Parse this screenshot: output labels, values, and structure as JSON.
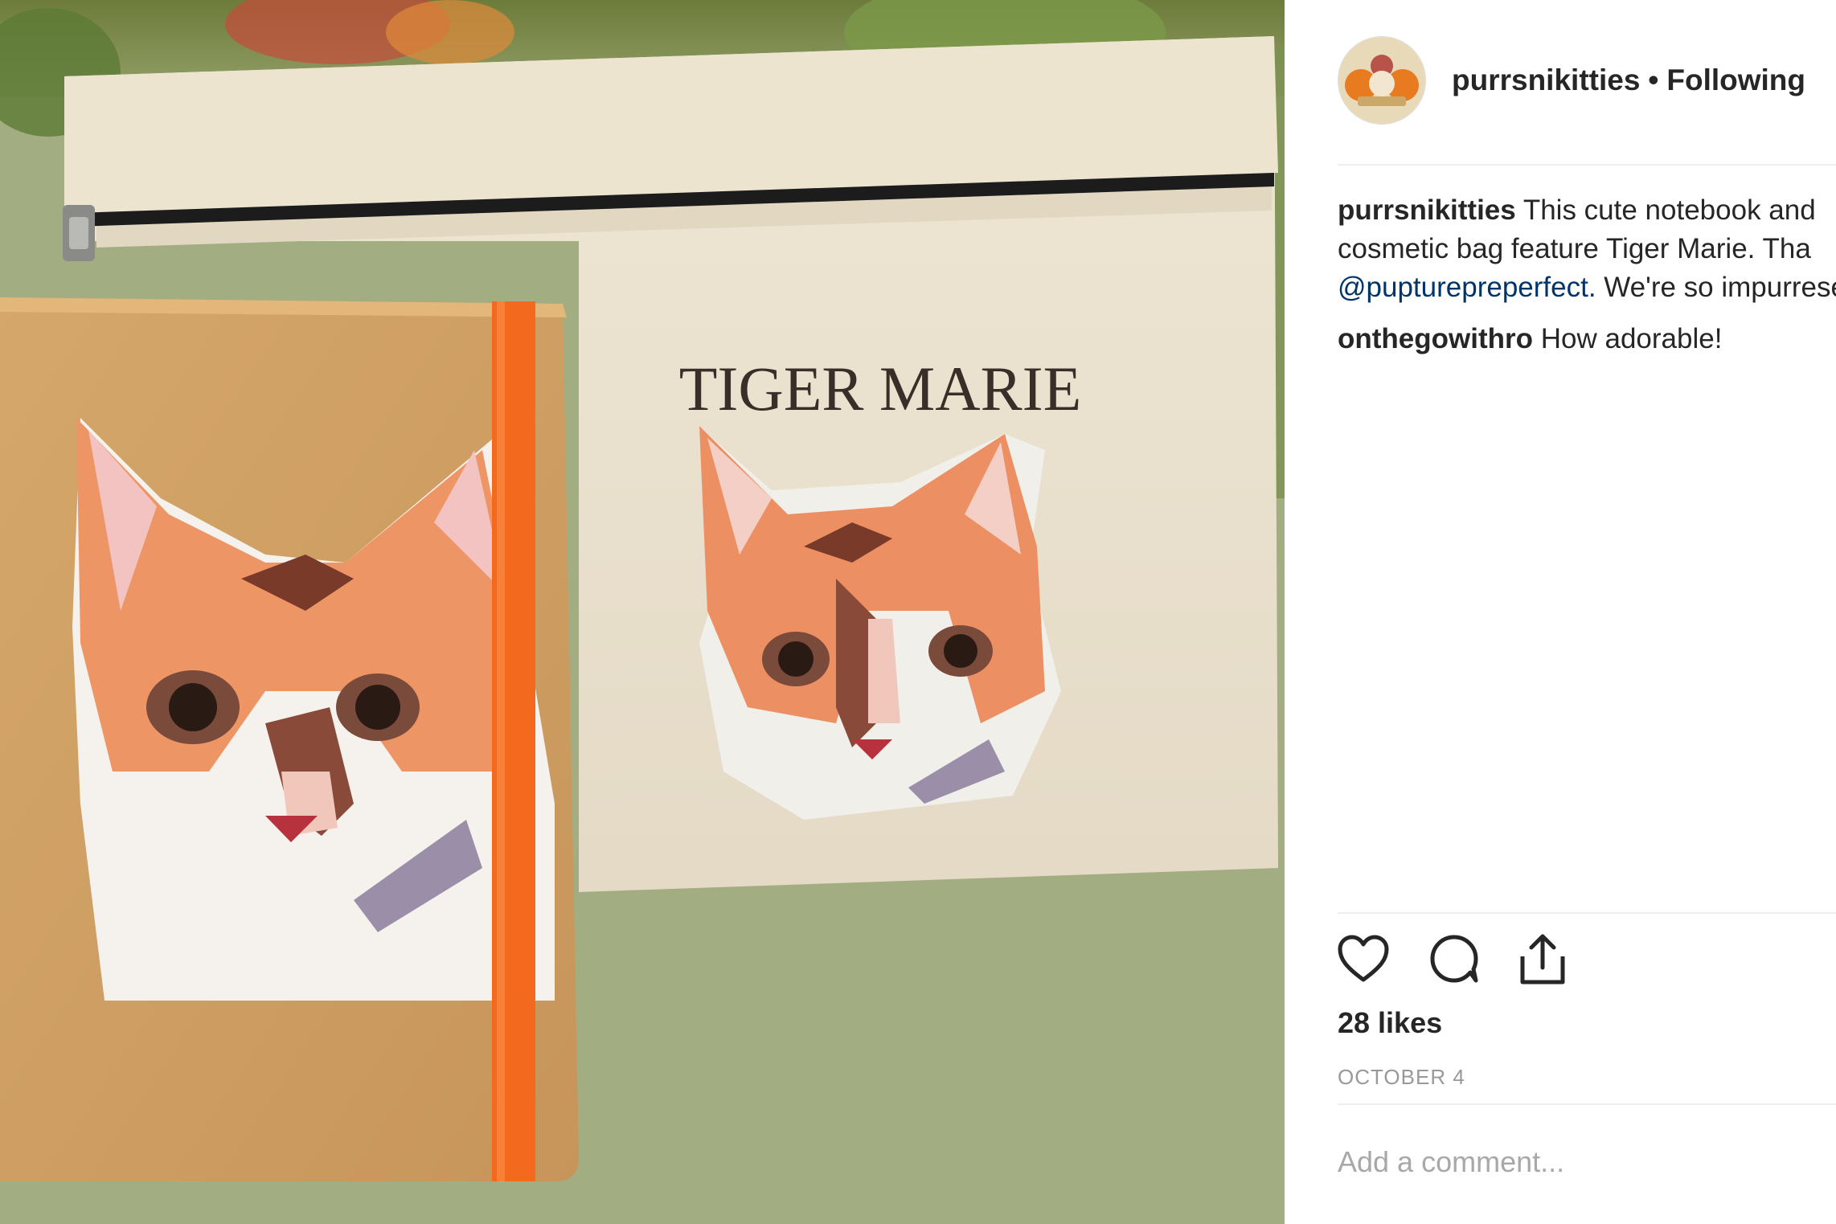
{
  "post": {
    "photo_text": "TIGER MARIE"
  },
  "header": {
    "username": "purrsnikitties",
    "separator": "•",
    "follow_status": "Following"
  },
  "comments": [
    {
      "user": "purrsnikitties",
      "text_1": "This cute notebook and",
      "line_2": "cosmetic bag feature Tiger Marie. Tha",
      "mention": "@pupturepreperfect.",
      "text_3": "We're so impurrese"
    },
    {
      "user": "onthegowithro",
      "text": "How adorable!"
    }
  ],
  "actions": {
    "like": "heart-icon",
    "comment": "comment-bubble-icon",
    "share": "share-icon"
  },
  "likes": "28 likes",
  "date": "OCTOBER 4",
  "add_comment": {
    "placeholder": "Add a comment..."
  },
  "colors": {
    "mention": "#003569",
    "muted": "#999999",
    "divider": "#efefef",
    "elastic_band": "#f36a1e"
  }
}
